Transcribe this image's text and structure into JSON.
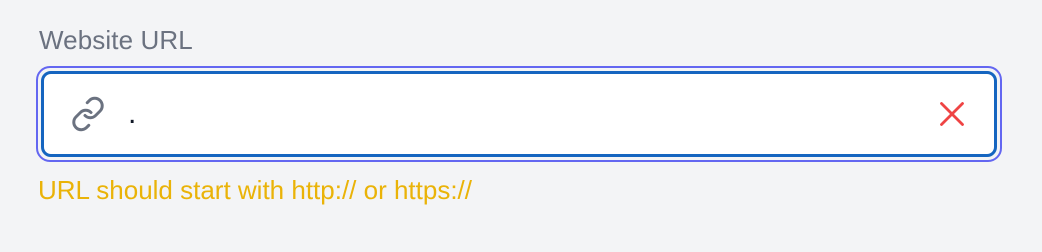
{
  "field": {
    "label": "Website URL",
    "value": ".",
    "icon": "link-icon",
    "clear_icon": "close-icon",
    "error_message": "URL should start with http:// or https://"
  },
  "colors": {
    "label": "#6b7280",
    "focus_ring": "#6366f1",
    "border": "#1565c0",
    "icon": "#6b7280",
    "clear": "#ef4444",
    "error": "#eab308",
    "background": "#f3f4f6"
  }
}
